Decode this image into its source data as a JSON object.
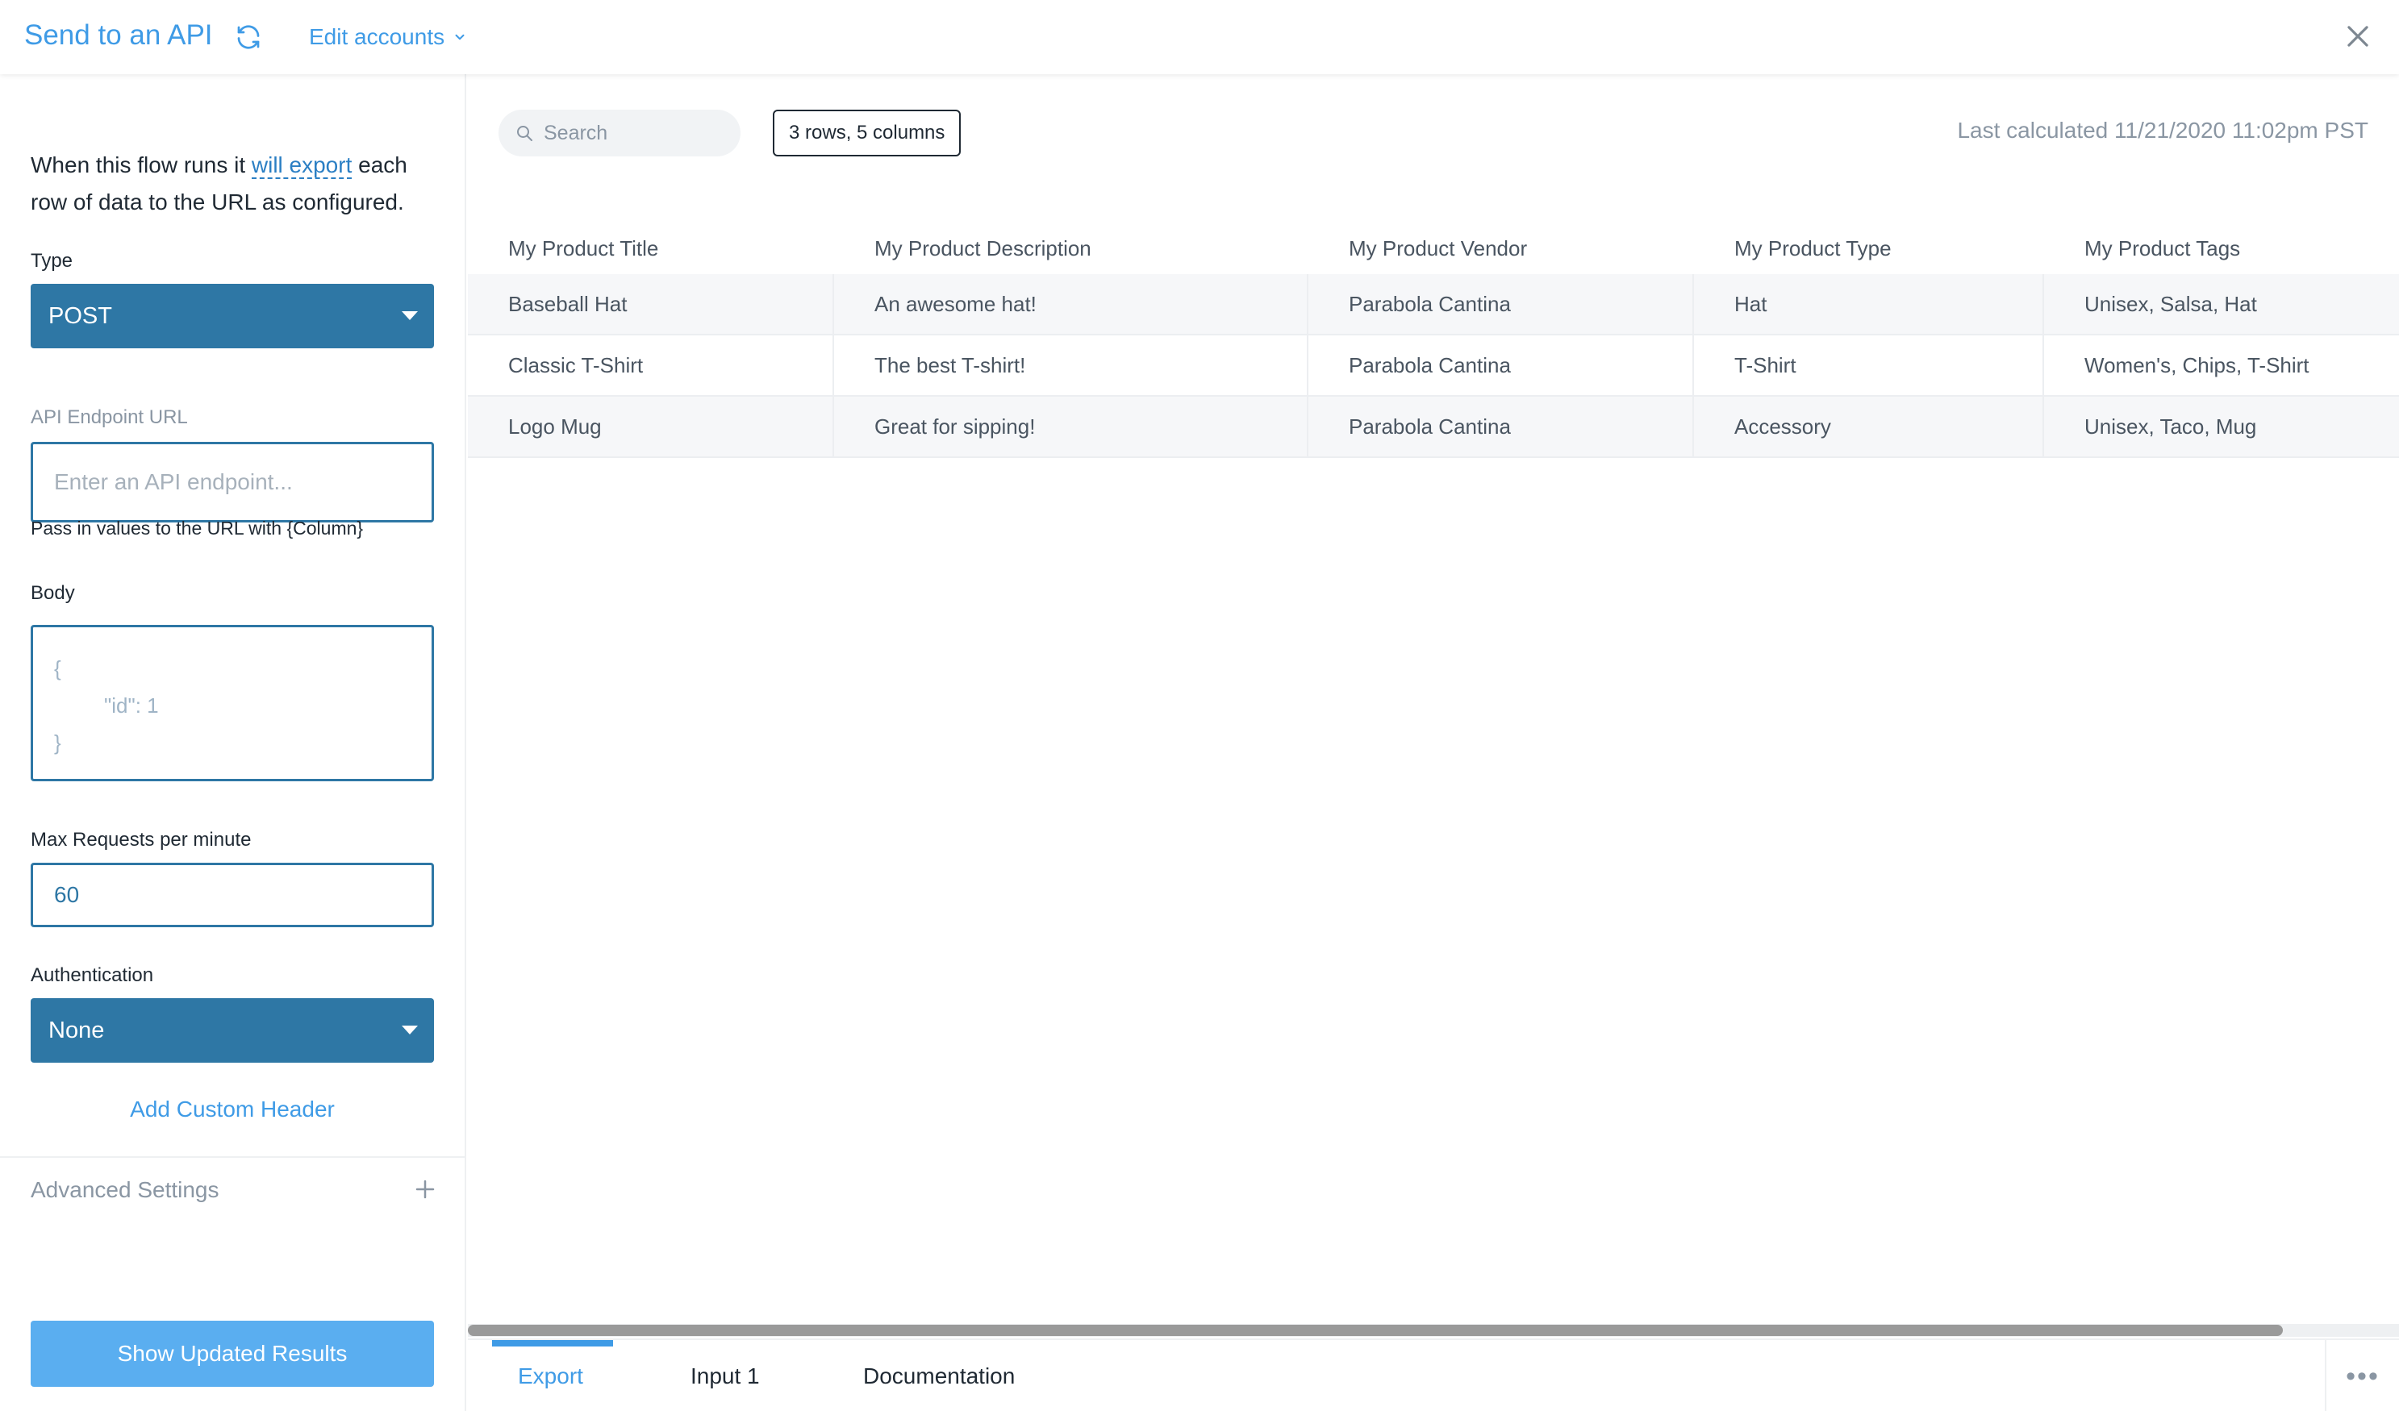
{
  "header": {
    "title": "Send to an API",
    "edit_accounts": "Edit accounts",
    "colors": {
      "accent": "#3f9be6"
    }
  },
  "sidebar": {
    "intro_prefix": "When this flow runs it ",
    "intro_link": "will export",
    "intro_suffix": " each row of data to the URL as configured.",
    "type_label": "Type",
    "type_value": "POST",
    "endpoint_label": "API Endpoint URL",
    "endpoint_placeholder": "Enter an API endpoint...",
    "endpoint_helper": "Pass in values to the URL with {Column}",
    "body_label": "Body",
    "body_line1": "{",
    "body_line2": "\"id\": 1",
    "body_line3": "}",
    "max_requests_label": "Max Requests per minute",
    "max_requests_value": "60",
    "auth_label": "Authentication",
    "auth_value": "None",
    "add_header": "Add Custom Header",
    "advanced_settings": "Advanced Settings",
    "show_results": "Show Updated Results",
    "colors": {
      "select_bg": "#2e77a5",
      "primary_button": "#5aaef0"
    }
  },
  "main": {
    "search_placeholder": "Search",
    "shape_badge": "3 rows, 5 columns",
    "last_calculated": "Last calculated 11/21/2020 11:02pm PST",
    "columns": [
      "My Product Title",
      "My Product Description",
      "My Product Vendor",
      "My Product Type",
      "My Product Tags"
    ],
    "rows": [
      [
        "Baseball Hat",
        "An awesome hat!",
        "Parabola Cantina",
        "Hat",
        "Unisex, Salsa, Hat"
      ],
      [
        "Classic T-Shirt",
        "The best T-shirt!",
        "Parabola Cantina",
        "T-Shirt",
        "Women's, Chips, T-Shirt"
      ],
      [
        "Logo Mug",
        "Great for sipping!",
        "Parabola Cantina",
        "Accessory",
        "Unisex, Taco, Mug"
      ]
    ],
    "tabs": [
      "Export",
      "Input 1",
      "Documentation"
    ],
    "active_tab": "Export",
    "more_icon": "more-horizontal-icon"
  }
}
